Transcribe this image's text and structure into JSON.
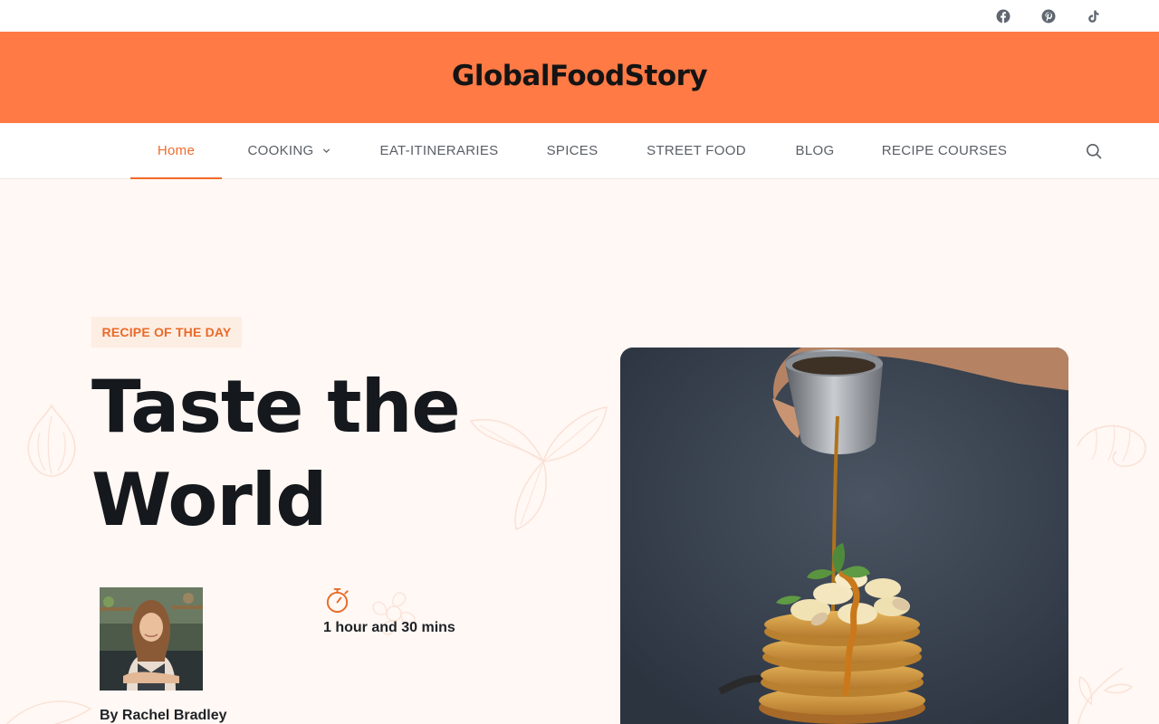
{
  "social": [
    {
      "name": "facebook-icon"
    },
    {
      "name": "pinterest-icon"
    },
    {
      "name": "tiktok-icon"
    }
  ],
  "brand": {
    "title": "GlobalFoodStory"
  },
  "nav": {
    "items": [
      {
        "label": "Home",
        "active": true
      },
      {
        "label": "COOKING",
        "dropdown": true
      },
      {
        "label": "EAT-ITINERARIES"
      },
      {
        "label": "SPICES"
      },
      {
        "label": "STREET FOOD"
      },
      {
        "label": "BLOG"
      },
      {
        "label": "RECIPE COURSES"
      }
    ],
    "search_icon": "search-icon"
  },
  "hero": {
    "badge": "RECIPE OF THE DAY",
    "title": "Taste the World",
    "author": "By Rachel Bradley",
    "duration": "1 hour and 30 mins",
    "timer_icon": "stopwatch-icon"
  },
  "colors": {
    "accent": "#ff7a45",
    "accent_text": "#f06b2a",
    "hero_bg": "#fff8f4",
    "dark_text": "#15181c"
  }
}
